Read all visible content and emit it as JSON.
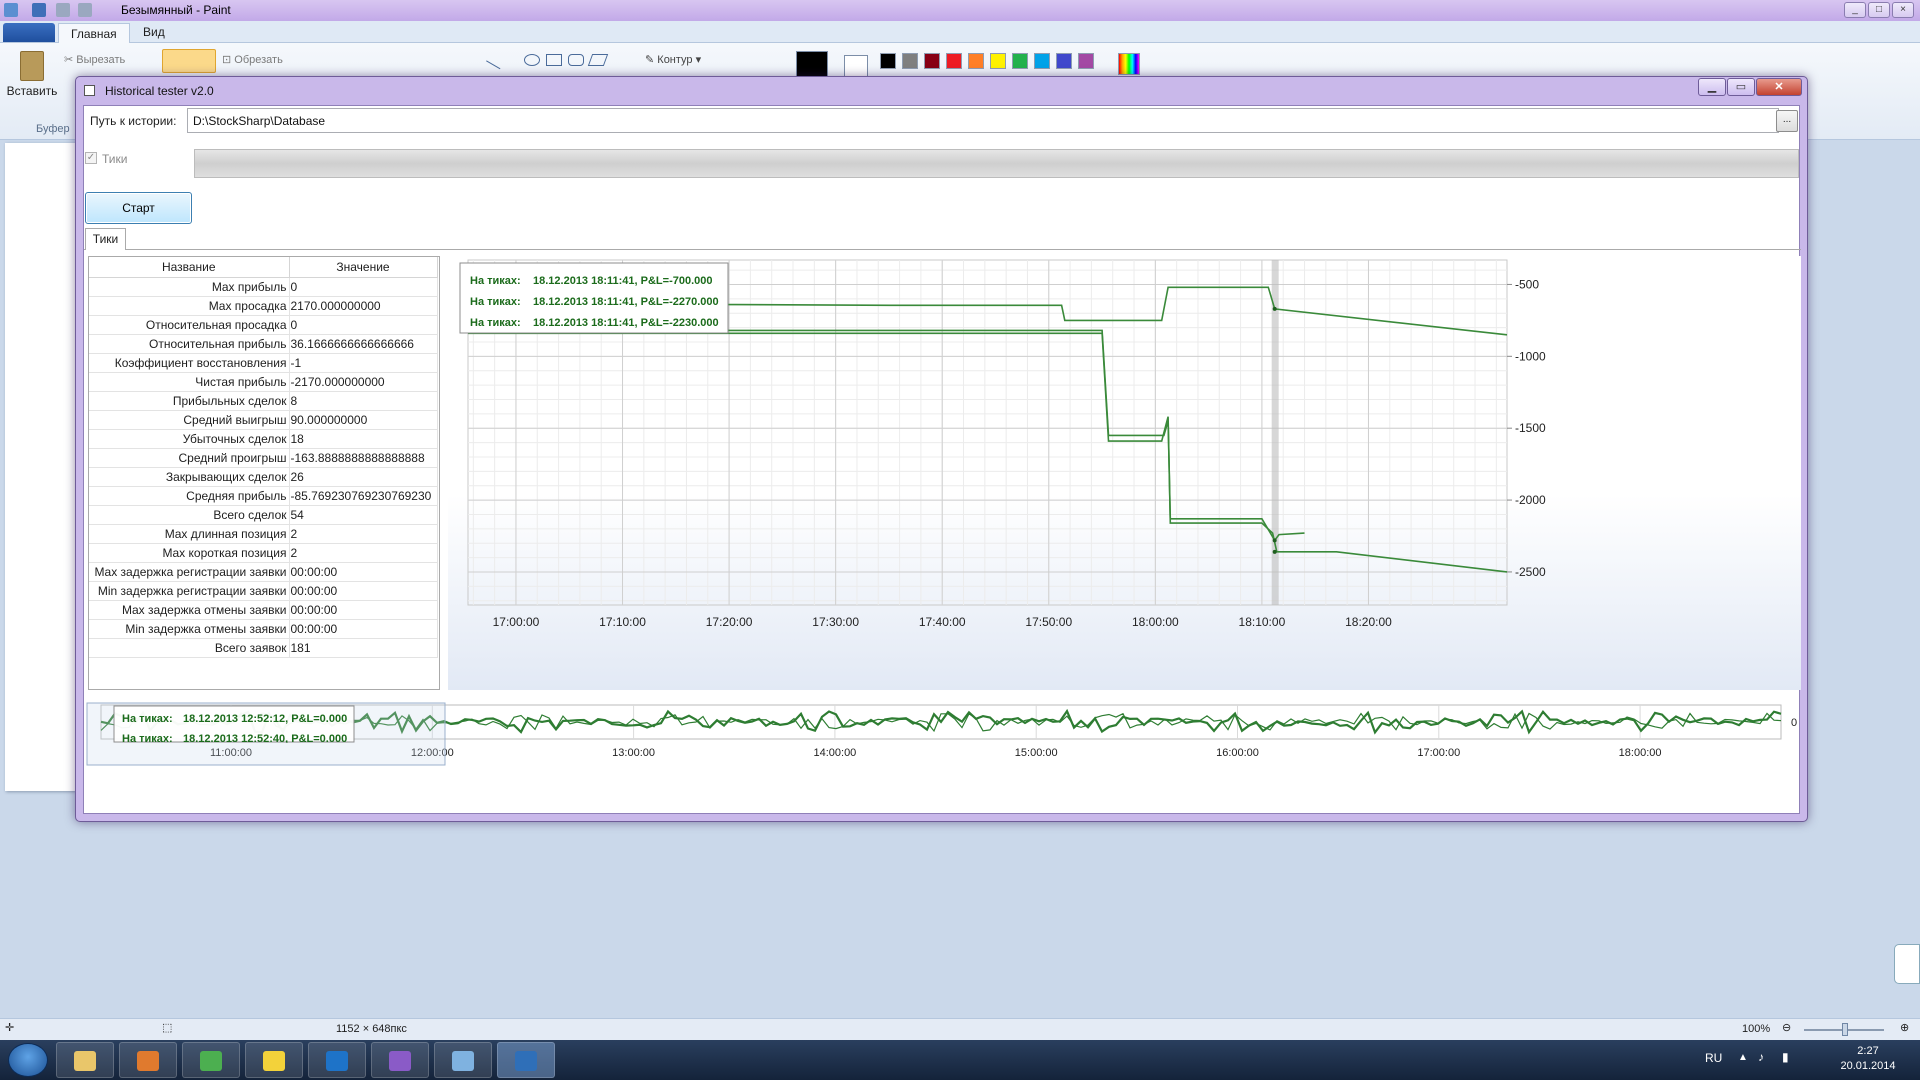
{
  "paint": {
    "title": "Безымянный - Paint",
    "tabs": [
      "Главная",
      "Вид"
    ],
    "paste_label": "Вставить",
    "cut_label": "Вырезать",
    "crop_label": "Обрезать",
    "buffer_label": "Буфер",
    "contour_label": "Контур",
    "canvas_size": "1152 × 648пкс",
    "zoom": "100%",
    "swatches": [
      "#000000",
      "#7f7f7f",
      "#880015",
      "#ed1c24",
      "#ff7f27",
      "#fff200",
      "#22b14c",
      "#00a2e8",
      "#3f48cc",
      "#a349a4"
    ]
  },
  "taskbar": {
    "lang": "RU",
    "time": "2:27",
    "date": "20.01.2014",
    "apps": [
      {
        "name": "explorer",
        "color": "#e9c66a"
      },
      {
        "name": "media-player",
        "color": "#e07a2e"
      },
      {
        "name": "chrome",
        "color": "#4caf50"
      },
      {
        "name": "help",
        "color": "#f3d23a"
      },
      {
        "name": "stocksharp",
        "color": "#1e73c8"
      },
      {
        "name": "visual-studio",
        "color": "#8a5bc7"
      },
      {
        "name": "paint",
        "color": "#7fb2e0"
      },
      {
        "name": "tester",
        "color": "#2f6fb8"
      }
    ]
  },
  "tester": {
    "title": "Historical tester v2.0",
    "path_label": "Путь к истории:",
    "path_value": "D:\\StockSharp\\Database",
    "browse_label": "...",
    "ticks_checkbox_label": "Тики",
    "ticks_checkbox_mark": "✓",
    "start_label": "Старт",
    "tab_label": "Тики",
    "table_headers": [
      "Название",
      "Значение"
    ],
    "stats": [
      {
        "name": "Max прибыль",
        "value": "0"
      },
      {
        "name": "Max просадка",
        "value": "2170.000000000"
      },
      {
        "name": "Относительная просадка",
        "value": "0"
      },
      {
        "name": "Относительная прибыль",
        "value": "36.1666666666666666"
      },
      {
        "name": "Коэффициент восстановления",
        "value": "-1"
      },
      {
        "name": "Чистая прибыль",
        "value": "-2170.000000000"
      },
      {
        "name": "Прибыльных сделок",
        "value": "8"
      },
      {
        "name": "Средний выигрыш",
        "value": "90.000000000"
      },
      {
        "name": "Убыточных сделок",
        "value": "18"
      },
      {
        "name": "Средний проигрыш",
        "value": "-163.8888888888888888"
      },
      {
        "name": "Закрывающих сделок",
        "value": "26"
      },
      {
        "name": "Средняя прибыль",
        "value": "-85.769230769230769230"
      },
      {
        "name": "Всего сделок",
        "value": "54"
      },
      {
        "name": "Max длинная позиция",
        "value": "2"
      },
      {
        "name": "Max короткая позиция",
        "value": "2"
      },
      {
        "name": "Max задержка регистрации заявки",
        "value": "00:00:00"
      },
      {
        "name": "Min задержка регистрации заявки",
        "value": "00:00:00"
      },
      {
        "name": "Max задержка отмены заявки",
        "value": "00:00:00"
      },
      {
        "name": "Min задержка отмены заявки",
        "value": "00:00:00"
      },
      {
        "name": "Всего заявок",
        "value": "181"
      }
    ]
  },
  "chart_data": [
    {
      "type": "line",
      "ylim": [
        -2730,
        -330
      ],
      "yticks": [
        -500,
        -1000,
        -1500,
        -2000,
        -2500
      ],
      "xticks": [
        "17:00:00",
        "17:10:00",
        "17:20:00",
        "17:30:00",
        "17:40:00",
        "17:50:00",
        "18:00:00",
        "18:10:00",
        "18:20:00"
      ],
      "xtick_minutes": [
        1020,
        1030,
        1040,
        1050,
        1060,
        1070,
        1080,
        1090,
        1100
      ],
      "xlim_minutes": [
        1015.5,
        1113.0
      ],
      "line_color": "#3a8a3a",
      "tooltip": {
        "label": "На тиках:",
        "entries": [
          "18.12.2013 18:11:41, P&L=-700.000",
          "18.12.2013 18:11:41, P&L=-2270.000",
          "18.12.2013 18:11:41, P&L=-2230.000"
        ]
      },
      "series": [
        {
          "points": [
            [
              1015.5,
              -640
            ],
            [
              1040.5,
              -640
            ],
            [
              1055.5,
              -645
            ],
            [
              1071.2,
              -645
            ],
            [
              1071.5,
              -750
            ],
            [
              1080.6,
              -750
            ],
            [
              1081.2,
              -520
            ],
            [
              1090.6,
              -520
            ],
            [
              1091.2,
              -670
            ],
            [
              1113.0,
              -850
            ]
          ]
        },
        {
          "points": [
            [
              1015.5,
              -820
            ],
            [
              1075.0,
              -820
            ],
            [
              1075.6,
              -1550
            ],
            [
              1080.8,
              -1550
            ],
            [
              1081.2,
              -1450
            ],
            [
              1081.4,
              -2130
            ],
            [
              1090.0,
              -2130
            ],
            [
              1090.8,
              -2230
            ],
            [
              1091.2,
              -2280
            ],
            [
              1091.6,
              -2240
            ],
            [
              1094.0,
              -2230
            ]
          ]
        },
        {
          "points": [
            [
              1015.5,
              -840
            ],
            [
              1075.0,
              -840
            ],
            [
              1075.6,
              -1590
            ],
            [
              1080.6,
              -1590
            ],
            [
              1081.2,
              -1420
            ],
            [
              1081.4,
              -2160
            ],
            [
              1090.0,
              -2160
            ],
            [
              1091.0,
              -2230
            ],
            [
              1091.4,
              -2360
            ],
            [
              1097.0,
              -2360
            ],
            [
              1113.0,
              -2500
            ]
          ]
        }
      ]
    },
    {
      "type": "line",
      "yticks": [
        0
      ],
      "xticks": [
        "11:00:00",
        "12:00:00",
        "13:00:00",
        "14:00:00",
        "15:00:00",
        "16:00:00",
        "17:00:00",
        "18:00:00"
      ],
      "line_color": "#2e7d32",
      "tooltip": {
        "label": "На тиках:",
        "entries": [
          "18.12.2013 12:52:12, P&L=0.000",
          "18.12.2013 12:52:40, P&L=0.000"
        ]
      }
    }
  ]
}
